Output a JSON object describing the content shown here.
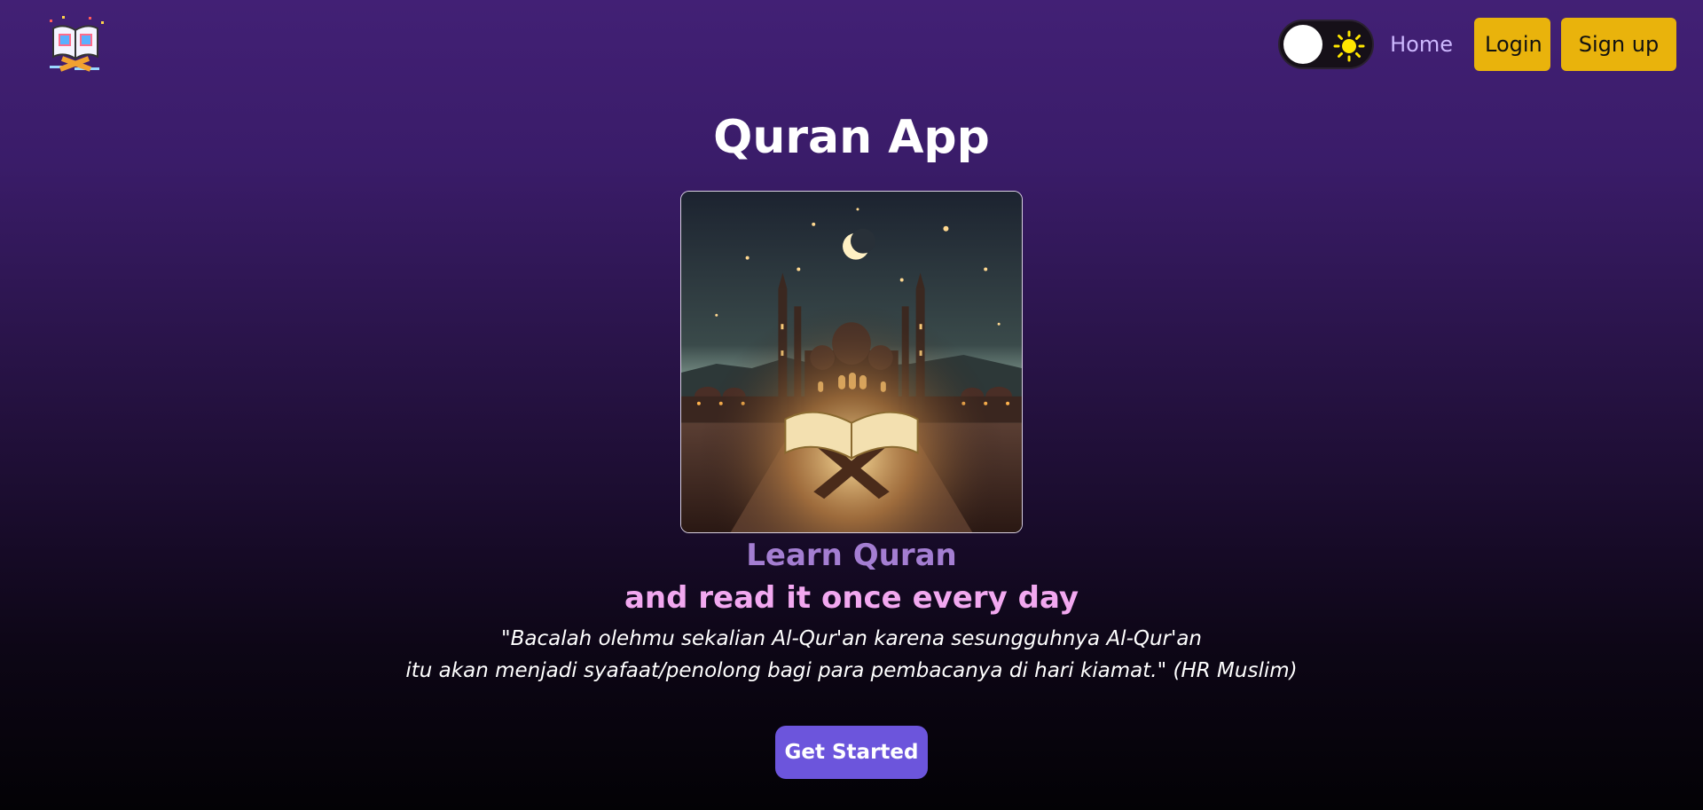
{
  "header": {
    "logo_icon": "open-book-quran-icon",
    "theme_toggle": {
      "state": "dark",
      "icon": "sun-icon"
    },
    "nav": {
      "home": "Home",
      "login": "Login",
      "signup": "Sign up"
    }
  },
  "main": {
    "title": "Quran App",
    "hero_image": "mosque-night-quran-illustration",
    "tagline_1": "Learn Quran",
    "tagline_2": "and read it once every day",
    "quote_line_1": "\"Bacalah olehmu sekalian Al-Qur'an karena sesungguhnya Al-Qur'an",
    "quote_line_2": "itu akan menjadi syafaat/penolong bagi para pembacanya di hari kiamat.\" (HR Muslim)",
    "cta": "Get Started"
  },
  "colors": {
    "accent_yellow": "#e9b30c",
    "cta_purple": "#6c55dc",
    "tagline_1": "#a47ed2",
    "tagline_2": "#f2a8f0"
  }
}
